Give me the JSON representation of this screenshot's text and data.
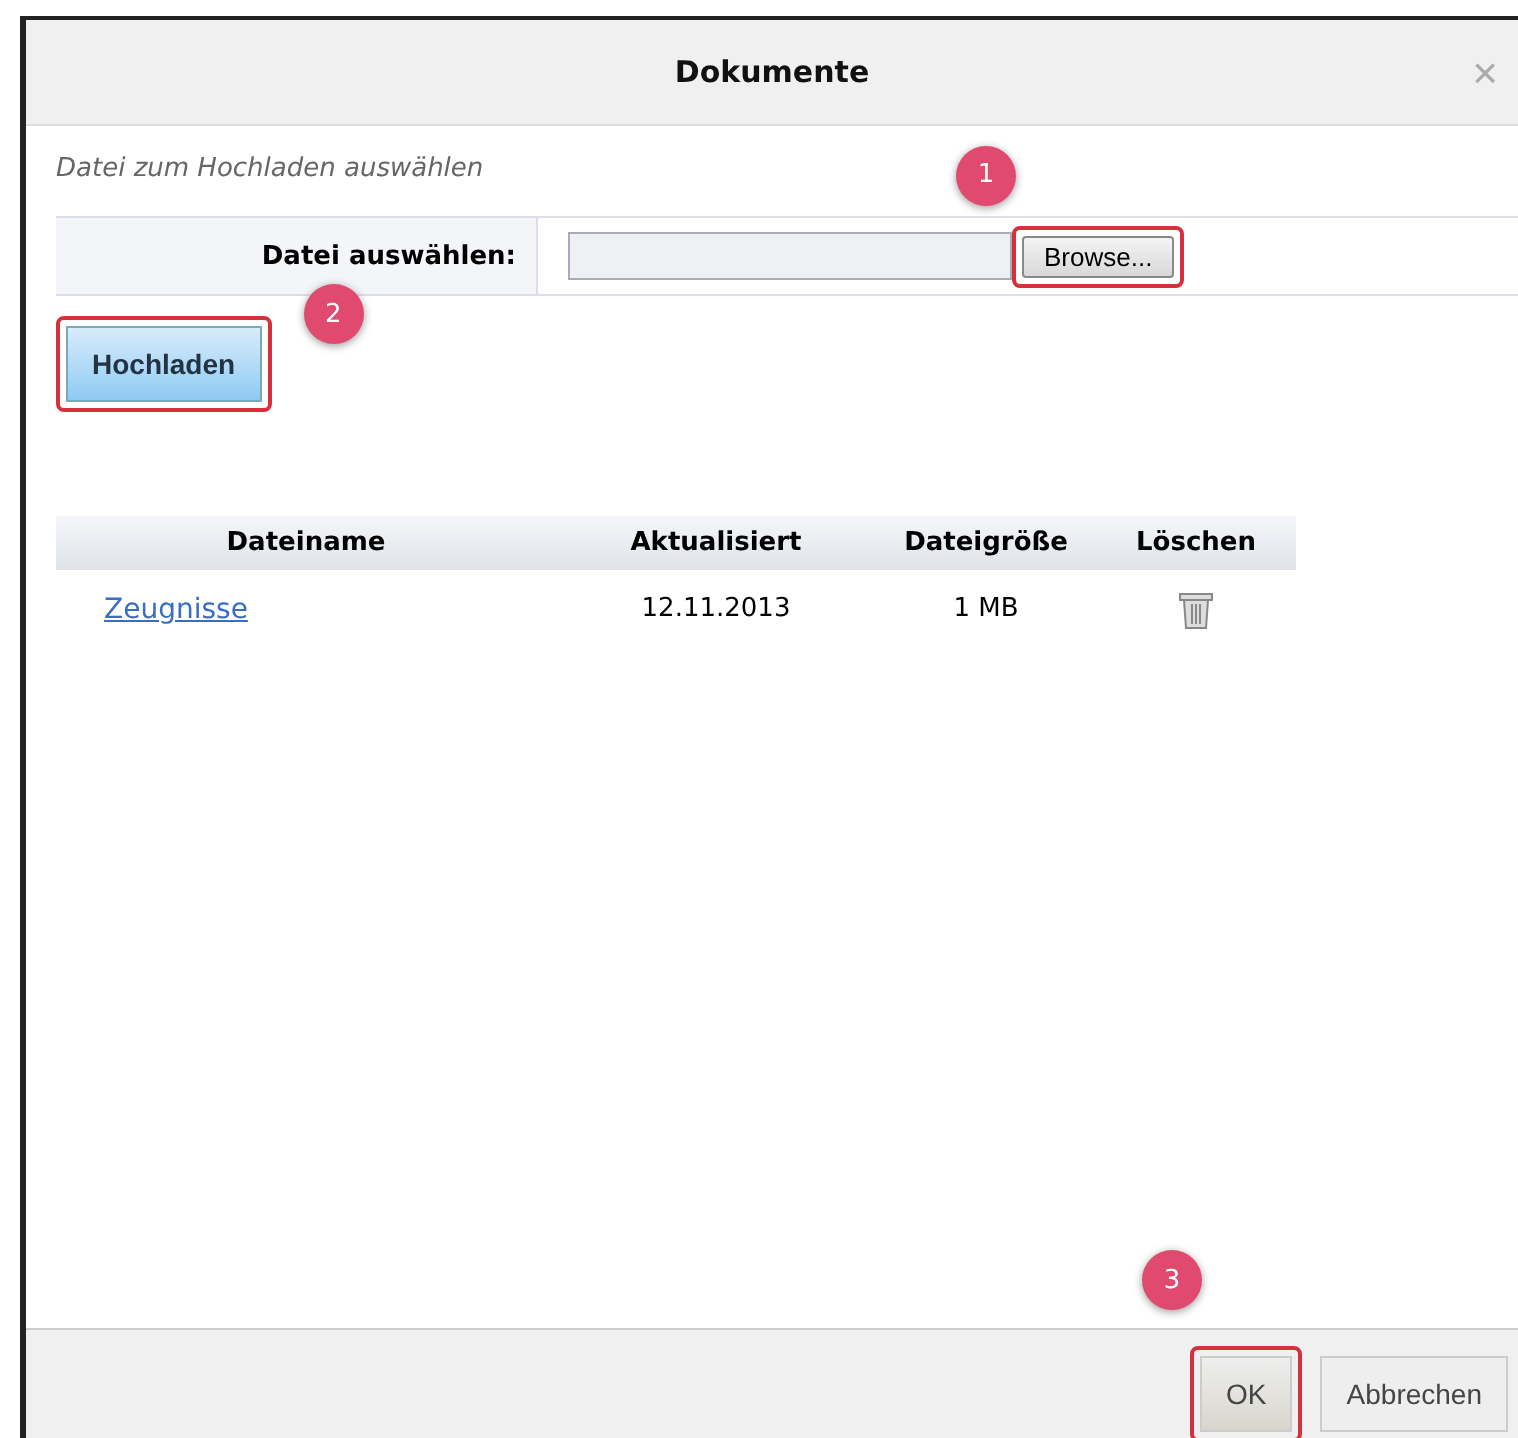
{
  "dialog": {
    "title": "Dokumente",
    "close": "×"
  },
  "instruction": "Datei zum Hochladen auswählen",
  "file_field": {
    "label": "Datei auswählen:",
    "browse_button": {
      "label": "Browse...",
      "callout": "1"
    }
  },
  "upload_button": {
    "label": "Hochladen",
    "callout": "2"
  },
  "table": {
    "columns": [
      "Dateiname",
      "Aktualisiert",
      "Dateigröße",
      "Löschen"
    ],
    "rows": [
      {
        "name": "Zeugnisse",
        "updated": "12.11.2013",
        "size": "1 MB"
      }
    ]
  },
  "footer": {
    "buttons": [
      {
        "label": "OK",
        "callout": "3"
      },
      {
        "label": "Abbrechen"
      }
    ]
  }
}
